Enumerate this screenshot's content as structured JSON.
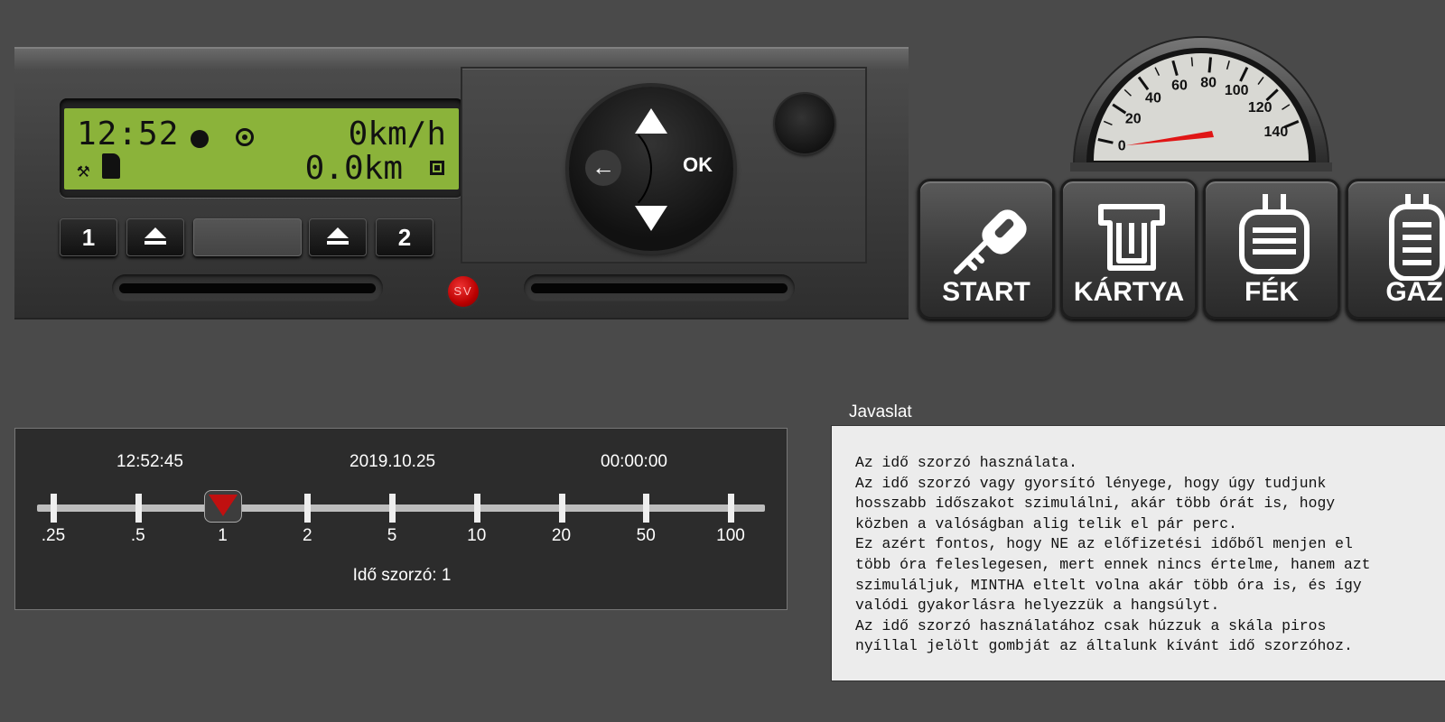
{
  "tachograph": {
    "display": {
      "time": "12:52",
      "speed": "0km/h",
      "distance": "0.0km"
    },
    "buttons": {
      "slot1_label": "1",
      "slot2_label": "2",
      "nav_ok_label": "OK",
      "nav_back_symbol": "←"
    },
    "sv_label": "SV"
  },
  "speedometer": {
    "scale_labels": [
      "0",
      "20",
      "40",
      "60",
      "80",
      "100",
      "120",
      "140"
    ],
    "max_value": 150,
    "needle_value": 0,
    "needle_color": "#e01515"
  },
  "controls": [
    {
      "label": "START",
      "icon": "key-icon"
    },
    {
      "label": "KÁRTYA",
      "icon": "card-icon"
    },
    {
      "label": "FÉK",
      "icon": "brake-pedal-icon"
    },
    {
      "label": "GÁZ",
      "icon": "gas-pedal-icon"
    }
  ],
  "multiplier": {
    "clock": "12:52:45",
    "date": "2019.10.25",
    "elapsed": "00:00:00",
    "ticks": [
      ".25",
      ".5",
      "1",
      "2",
      "5",
      "10",
      "20",
      "50",
      "100"
    ],
    "selected_index": 2,
    "caption": "Idő szorzó: 1"
  },
  "suggestion": {
    "title": "Javaslat",
    "lines": [
      "Az idő szorzó használata.",
      "Az idő szorzó vagy gyorsító lényege, hogy úgy tudjunk",
      "hosszabb időszakot szimulálni, akár több órát is, hogy",
      "közben a valóságban alig telik el pár perc.",
      "Ez azért fontos, hogy NE az előfizetési időből menjen el",
      "több óra feleslegesen, mert ennek nincs értelme, hanem azt",
      "szimuláljuk, MINTHA eltelt volna akár több óra is, és így",
      "valódi gyakorlásra helyezzük a hangsúlyt.",
      "Az idő szorzó használatához csak húzzuk a skála piros",
      "nyíllal jelölt gombját az általunk kívánt idő szorzóhoz."
    ]
  }
}
